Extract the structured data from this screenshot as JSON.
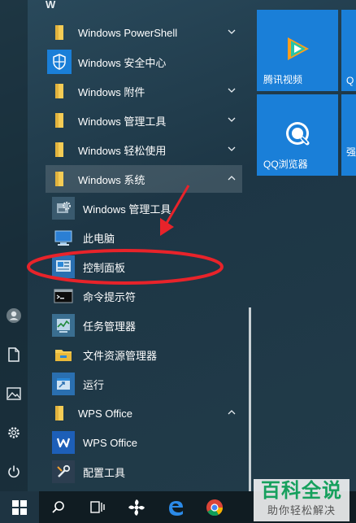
{
  "start_menu": {
    "section_letter": "W",
    "apps": [
      {
        "label": "Windows PowerShell",
        "icon": "folder-icon",
        "chevron": "chevron-down"
      },
      {
        "label": "Windows 安全中心",
        "icon": "shield-icon",
        "chevron": ""
      },
      {
        "label": "Windows 附件",
        "icon": "folder-icon",
        "chevron": "chevron-down"
      },
      {
        "label": "Windows 管理工具",
        "icon": "folder-icon",
        "chevron": "chevron-down"
      },
      {
        "label": "Windows 轻松使用",
        "icon": "folder-icon",
        "chevron": "chevron-down"
      },
      {
        "label": "Windows 系统",
        "icon": "folder-icon",
        "chevron": "chevron-up"
      }
    ],
    "system_items": [
      {
        "label": "Windows 管理工具",
        "icon": "admin-tools-icon"
      },
      {
        "label": "此电脑",
        "icon": "computer-icon"
      },
      {
        "label": "控制面板",
        "icon": "control-panel-icon"
      },
      {
        "label": "命令提示符",
        "icon": "cmd-icon"
      },
      {
        "label": "任务管理器",
        "icon": "task-manager-icon"
      },
      {
        "label": "文件资源管理器",
        "icon": "file-explorer-icon"
      },
      {
        "label": "运行",
        "icon": "run-icon"
      }
    ],
    "wps_group": {
      "label": "WPS Office",
      "icon": "folder-icon",
      "chevron": "chevron-up"
    },
    "wps_items": [
      {
        "label": "WPS Office",
        "icon": "wps-icon"
      },
      {
        "label": "配置工具",
        "icon": "config-tool-icon"
      }
    ]
  },
  "tiles": [
    {
      "label": "腾讯视频",
      "icon": "tencent-video-icon"
    },
    {
      "label": "QQ浏览器",
      "icon": "qq-browser-icon"
    }
  ],
  "partial_tiles": [
    {
      "label": "Q"
    },
    {
      "label": "强"
    }
  ],
  "left_rail": [
    "user-icon",
    "document-icon",
    "pictures-icon",
    "settings-icon",
    "power-icon"
  ],
  "taskbar": [
    "windows-start-icon",
    "search-icon",
    "task-view-icon",
    "fan-app-icon",
    "edge-icon",
    "chrome-icon"
  ],
  "watermark": {
    "title": "百科全说",
    "subtitle": "助你轻松解决"
  },
  "colors": {
    "tile_blue": "#1a7fd8",
    "annotation_red": "#e8232a",
    "folder_yellow": "#f5cc55",
    "watermark_green": "#16a05d"
  }
}
